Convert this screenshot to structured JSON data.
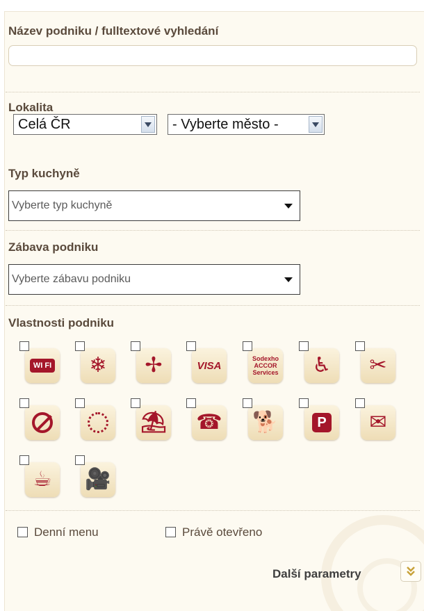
{
  "name_search": {
    "label": "Název podniku / fulltextové vyhledání",
    "value": ""
  },
  "locality": {
    "label": "Lokalita",
    "region_value": "Celá ČR",
    "city_value": "- Vyberte město -"
  },
  "cuisine": {
    "label": "Typ kuchyně",
    "value": "Vyberte typ kuchyně"
  },
  "entertainment": {
    "label": "Zábava podniku",
    "value": "Vyberte zábavu podniku"
  },
  "features": {
    "label": "Vlastnosti podniku",
    "icons": [
      {
        "name": "wifi-icon",
        "text": "WI FI"
      },
      {
        "name": "air-conditioning-icon",
        "text": "❄"
      },
      {
        "name": "fan-icon",
        "text": "✢"
      },
      {
        "name": "visa-card-icon",
        "text": "VISA"
      },
      {
        "name": "sodexho-voucher-icon",
        "text": "Sodexho ACCOR Services"
      },
      {
        "name": "wheelchair-access-icon",
        "text": "♿"
      },
      {
        "name": "baby-icon",
        "text": "✂"
      },
      {
        "name": "no-smoking-icon",
        "text": ""
      },
      {
        "name": "smoking-zone-icon",
        "text": ""
      },
      {
        "name": "terrace-icon",
        "text": "⛱"
      },
      {
        "name": "phone-reservation-icon",
        "text": "☎"
      },
      {
        "name": "pets-allowed-icon",
        "text": "🐕"
      },
      {
        "name": "parking-icon",
        "text": "P"
      },
      {
        "name": "wallet-icon",
        "text": "✉"
      },
      {
        "name": "coffee-icon",
        "text": "☕"
      },
      {
        "name": "video-camera-icon",
        "text": "🎥"
      }
    ]
  },
  "daily_menu_label": "Denní menu",
  "open_now_label": "Právě otevřeno",
  "more_params_label": "Další parametry",
  "more_params_icon": "double-chevron-down-icon",
  "colors": {
    "accent": "#a4162a",
    "panel_bg": "#fdfaf1",
    "label_text": "#5a4a3c",
    "expand_icon": "#c8a23a"
  }
}
